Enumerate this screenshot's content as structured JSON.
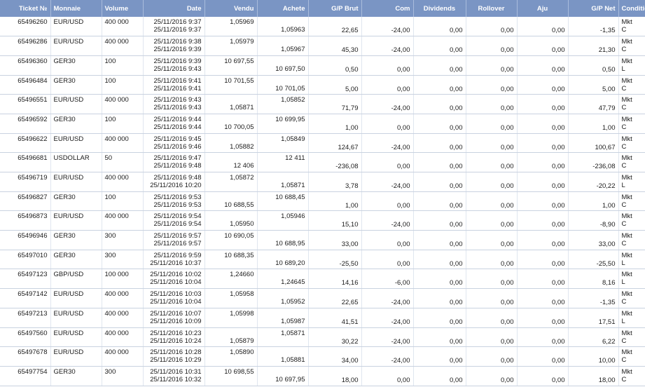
{
  "columns": [
    {
      "key": "ticket",
      "label": "Ticket №"
    },
    {
      "key": "monnaie",
      "label": "Monnaie"
    },
    {
      "key": "volume",
      "label": "Volume"
    },
    {
      "key": "date",
      "label": "Date"
    },
    {
      "key": "vendu",
      "label": "Vendu"
    },
    {
      "key": "achete",
      "label": "Achete"
    },
    {
      "key": "gp_brut",
      "label": "G/P Brut"
    },
    {
      "key": "com",
      "label": "Com"
    },
    {
      "key": "dividends",
      "label": "Dividends"
    },
    {
      "key": "rollover",
      "label": "Rollover"
    },
    {
      "key": "aju",
      "label": "Aju"
    },
    {
      "key": "gp_net",
      "label": "G/P Net"
    },
    {
      "key": "condition",
      "label": "Condition"
    }
  ],
  "rows": [
    {
      "ticket": "65496260",
      "monnaie": "EUR/USD",
      "volume": "400 000",
      "date1": "25/11/2016 9:37",
      "date2": "25/11/2016 9:37",
      "vendu1": "1,05969",
      "vendu2": "",
      "achete1": "",
      "achete2": "1,05963",
      "gp_brut": "22,65",
      "com": "-24,00",
      "dividends": "0,00",
      "rollover": "0,00",
      "aju": "0,00",
      "gp_net": "-1,35",
      "cond1": "Mkt",
      "cond2": "C"
    },
    {
      "ticket": "65496286",
      "monnaie": "EUR/USD",
      "volume": "400 000",
      "date1": "25/11/2016 9:38",
      "date2": "25/11/2016 9:39",
      "vendu1": "1,05979",
      "vendu2": "",
      "achete1": "",
      "achete2": "1,05967",
      "gp_brut": "45,30",
      "com": "-24,00",
      "dividends": "0,00",
      "rollover": "0,00",
      "aju": "0,00",
      "gp_net": "21,30",
      "cond1": "Mkt",
      "cond2": "C"
    },
    {
      "ticket": "65496360",
      "monnaie": "GER30",
      "volume": "100",
      "date1": "25/11/2016 9:39",
      "date2": "25/11/2016 9:43",
      "vendu1": "10 697,55",
      "vendu2": "",
      "achete1": "",
      "achete2": "10 697,50",
      "gp_brut": "0,50",
      "com": "0,00",
      "dividends": "0,00",
      "rollover": "0,00",
      "aju": "0,00",
      "gp_net": "0,50",
      "cond1": "Mkt",
      "cond2": "L"
    },
    {
      "ticket": "65496484",
      "monnaie": "GER30",
      "volume": "100",
      "date1": "25/11/2016 9:41",
      "date2": "25/11/2016 9:41",
      "vendu1": "10 701,55",
      "vendu2": "",
      "achete1": "",
      "achete2": "10 701,05",
      "gp_brut": "5,00",
      "com": "0,00",
      "dividends": "0,00",
      "rollover": "0,00",
      "aju": "0,00",
      "gp_net": "5,00",
      "cond1": "Mkt",
      "cond2": "C"
    },
    {
      "ticket": "65496551",
      "monnaie": "EUR/USD",
      "volume": "400 000",
      "date1": "25/11/2016 9:43",
      "date2": "25/11/2016 9:43",
      "vendu1": "",
      "vendu2": "1,05871",
      "achete1": "1,05852",
      "achete2": "",
      "gp_brut": "71,79",
      "com": "-24,00",
      "dividends": "0,00",
      "rollover": "0,00",
      "aju": "0,00",
      "gp_net": "47,79",
      "cond1": "Mkt",
      "cond2": "C"
    },
    {
      "ticket": "65496592",
      "monnaie": "GER30",
      "volume": "100",
      "date1": "25/11/2016 9:44",
      "date2": "25/11/2016 9:44",
      "vendu1": "",
      "vendu2": "10 700,05",
      "achete1": "10 699,95",
      "achete2": "",
      "gp_brut": "1,00",
      "com": "0,00",
      "dividends": "0,00",
      "rollover": "0,00",
      "aju": "0,00",
      "gp_net": "1,00",
      "cond1": "Mkt",
      "cond2": "C"
    },
    {
      "ticket": "65496622",
      "monnaie": "EUR/USD",
      "volume": "400 000",
      "date1": "25/11/2016 9:45",
      "date2": "25/11/2016 9:46",
      "vendu1": "",
      "vendu2": "1,05882",
      "achete1": "1,05849",
      "achete2": "",
      "gp_brut": "124,67",
      "com": "-24,00",
      "dividends": "0,00",
      "rollover": "0,00",
      "aju": "0,00",
      "gp_net": "100,67",
      "cond1": "Mkt",
      "cond2": "C"
    },
    {
      "ticket": "65496681",
      "monnaie": "USDOLLAR",
      "volume": "50",
      "date1": "25/11/2016 9:47",
      "date2": "25/11/2016 9:48",
      "vendu1": "",
      "vendu2": "12 406",
      "achete1": "12 411",
      "achete2": "",
      "gp_brut": "-236,08",
      "com": "0,00",
      "dividends": "0,00",
      "rollover": "0,00",
      "aju": "0,00",
      "gp_net": "-236,08",
      "cond1": "Mkt",
      "cond2": "C"
    },
    {
      "ticket": "65496719",
      "monnaie": "EUR/USD",
      "volume": "400 000",
      "date1": "25/11/2016 9:48",
      "date2": "25/11/2016 10:20",
      "vendu1": "1,05872",
      "vendu2": "",
      "achete1": "",
      "achete2": "1,05871",
      "gp_brut": "3,78",
      "com": "-24,00",
      "dividends": "0,00",
      "rollover": "0,00",
      "aju": "0,00",
      "gp_net": "-20,22",
      "cond1": "Mkt",
      "cond2": "L"
    },
    {
      "ticket": "65496827",
      "monnaie": "GER30",
      "volume": "100",
      "date1": "25/11/2016 9:53",
      "date2": "25/11/2016 9:53",
      "vendu1": "",
      "vendu2": "10 688,55",
      "achete1": "10 688,45",
      "achete2": "",
      "gp_brut": "1,00",
      "com": "0,00",
      "dividends": "0,00",
      "rollover": "0,00",
      "aju": "0,00",
      "gp_net": "1,00",
      "cond1": "Mkt",
      "cond2": "C"
    },
    {
      "ticket": "65496873",
      "monnaie": "EUR/USD",
      "volume": "400 000",
      "date1": "25/11/2016 9:54",
      "date2": "25/11/2016 9:54",
      "vendu1": "",
      "vendu2": "1,05950",
      "achete1": "1,05946",
      "achete2": "",
      "gp_brut": "15,10",
      "com": "-24,00",
      "dividends": "0,00",
      "rollover": "0,00",
      "aju": "0,00",
      "gp_net": "-8,90",
      "cond1": "Mkt",
      "cond2": "C"
    },
    {
      "ticket": "65496946",
      "monnaie": "GER30",
      "volume": "300",
      "date1": "25/11/2016 9:57",
      "date2": "25/11/2016 9:57",
      "vendu1": "10 690,05",
      "vendu2": "",
      "achete1": "",
      "achete2": "10 688,95",
      "gp_brut": "33,00",
      "com": "0,00",
      "dividends": "0,00",
      "rollover": "0,00",
      "aju": "0,00",
      "gp_net": "33,00",
      "cond1": "Mkt",
      "cond2": "C"
    },
    {
      "ticket": "65497010",
      "monnaie": "GER30",
      "volume": "300",
      "date1": "25/11/2016 9:59",
      "date2": "25/11/2016 10:37",
      "vendu1": "10 688,35",
      "vendu2": "",
      "achete1": "",
      "achete2": "10 689,20",
      "gp_brut": "-25,50",
      "com": "0,00",
      "dividends": "0,00",
      "rollover": "0,00",
      "aju": "0,00",
      "gp_net": "-25,50",
      "cond1": "Mkt",
      "cond2": "L"
    },
    {
      "ticket": "65497123",
      "monnaie": "GBP/USD",
      "volume": "100 000",
      "date1": "25/11/2016 10:02",
      "date2": "25/11/2016 10:04",
      "vendu1": "1,24660",
      "vendu2": "",
      "achete1": "",
      "achete2": "1,24645",
      "gp_brut": "14,16",
      "com": "-6,00",
      "dividends": "0,00",
      "rollover": "0,00",
      "aju": "0,00",
      "gp_net": "8,16",
      "cond1": "Mkt",
      "cond2": "L"
    },
    {
      "ticket": "65497142",
      "monnaie": "EUR/USD",
      "volume": "400 000",
      "date1": "25/11/2016 10:03",
      "date2": "25/11/2016 10:04",
      "vendu1": "1,05958",
      "vendu2": "",
      "achete1": "",
      "achete2": "1,05952",
      "gp_brut": "22,65",
      "com": "-24,00",
      "dividends": "0,00",
      "rollover": "0,00",
      "aju": "0,00",
      "gp_net": "-1,35",
      "cond1": "Mkt",
      "cond2": "C"
    },
    {
      "ticket": "65497213",
      "monnaie": "EUR/USD",
      "volume": "400 000",
      "date1": "25/11/2016 10:07",
      "date2": "25/11/2016 10:09",
      "vendu1": "1,05998",
      "vendu2": "",
      "achete1": "",
      "achete2": "1,05987",
      "gp_brut": "41,51",
      "com": "-24,00",
      "dividends": "0,00",
      "rollover": "0,00",
      "aju": "0,00",
      "gp_net": "17,51",
      "cond1": "Mkt",
      "cond2": "L"
    },
    {
      "ticket": "65497560",
      "monnaie": "EUR/USD",
      "volume": "400 000",
      "date1": "25/11/2016 10:23",
      "date2": "25/11/2016 10:24",
      "vendu1": "",
      "vendu2": "1,05879",
      "achete1": "1,05871",
      "achete2": "",
      "gp_brut": "30,22",
      "com": "-24,00",
      "dividends": "0,00",
      "rollover": "0,00",
      "aju": "0,00",
      "gp_net": "6,22",
      "cond1": "Mkt",
      "cond2": "C"
    },
    {
      "ticket": "65497678",
      "monnaie": "EUR/USD",
      "volume": "400 000",
      "date1": "25/11/2016 10:28",
      "date2": "25/11/2016 10:29",
      "vendu1": "1,05890",
      "vendu2": "",
      "achete1": "",
      "achete2": "1,05881",
      "gp_brut": "34,00",
      "com": "-24,00",
      "dividends": "0,00",
      "rollover": "0,00",
      "aju": "0,00",
      "gp_net": "10,00",
      "cond1": "Mkt",
      "cond2": "C"
    },
    {
      "ticket": "65497754",
      "monnaie": "GER30",
      "volume": "300",
      "date1": "25/11/2016 10:31",
      "date2": "25/11/2016 10:32",
      "vendu1": "10 698,55",
      "vendu2": "",
      "achete1": "",
      "achete2": "10 697,95",
      "gp_brut": "18,00",
      "com": "0,00",
      "dividends": "0,00",
      "rollover": "0,00",
      "aju": "0,00",
      "gp_net": "18,00",
      "cond1": "Mkt",
      "cond2": "C"
    }
  ]
}
